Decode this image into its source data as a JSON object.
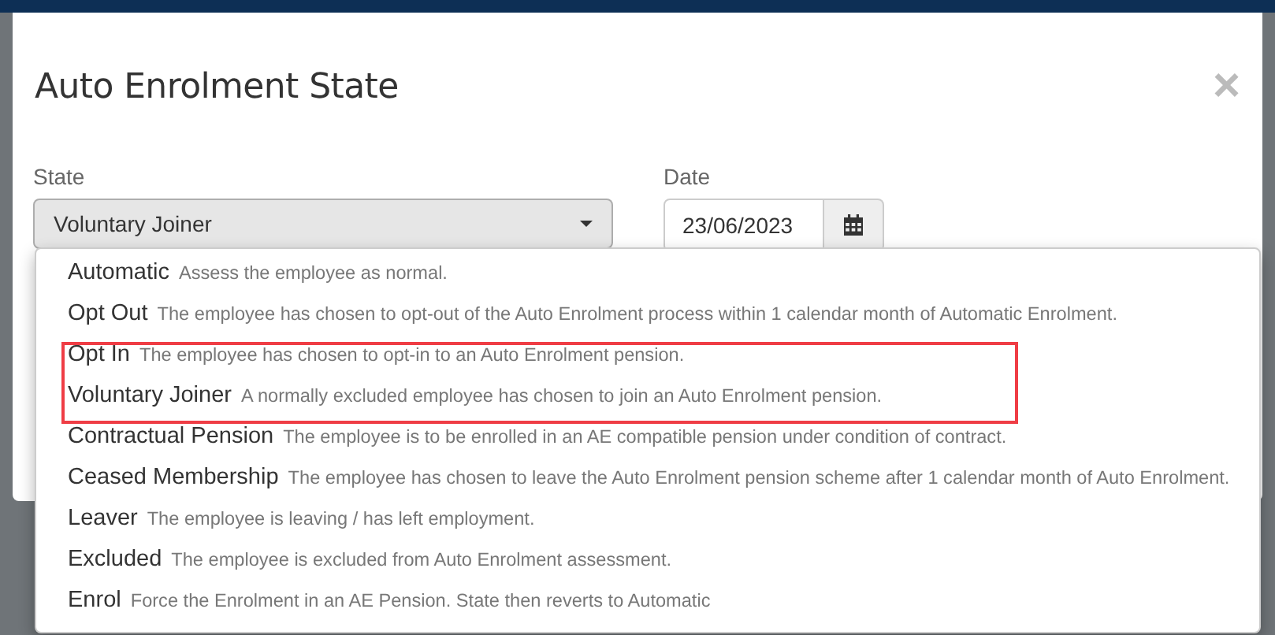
{
  "dialog": {
    "title": "Auto Enrolment State",
    "close": "×"
  },
  "state_field": {
    "label": "State",
    "value": "Voluntary Joiner"
  },
  "date_field": {
    "label": "Date",
    "value": "23/06/2023"
  },
  "options": [
    {
      "label": "Automatic",
      "description": "Assess the employee as normal.",
      "highlighted": false
    },
    {
      "label": "Opt Out",
      "description": "The employee has chosen to opt-out of the Auto Enrolment process within 1 calendar month of Automatic Enrolment.",
      "highlighted": false
    },
    {
      "label": "Opt In",
      "description": "The employee has chosen to opt-in to an Auto Enrolment pension.",
      "highlighted": true
    },
    {
      "label": "Voluntary Joiner",
      "description": "A normally excluded employee has chosen to join an Auto Enrolment pension.",
      "highlighted": true
    },
    {
      "label": "Contractual Pension",
      "description": "The employee is to be enrolled in an AE compatible pension under condition of contract.",
      "highlighted": false
    },
    {
      "label": "Ceased Membership",
      "description": "The employee has chosen to leave the Auto Enrolment pension scheme after 1 calendar month of Auto Enrolment.",
      "highlighted": false
    },
    {
      "label": "Leaver",
      "description": "The employee is leaving / has left employment.",
      "highlighted": false
    },
    {
      "label": "Excluded",
      "description": "The employee is excluded from Auto Enrolment assessment.",
      "highlighted": false
    },
    {
      "label": "Enrol",
      "description": "Force the Enrolment in an AE Pension. State then reverts to Automatic",
      "highlighted": false
    }
  ]
}
